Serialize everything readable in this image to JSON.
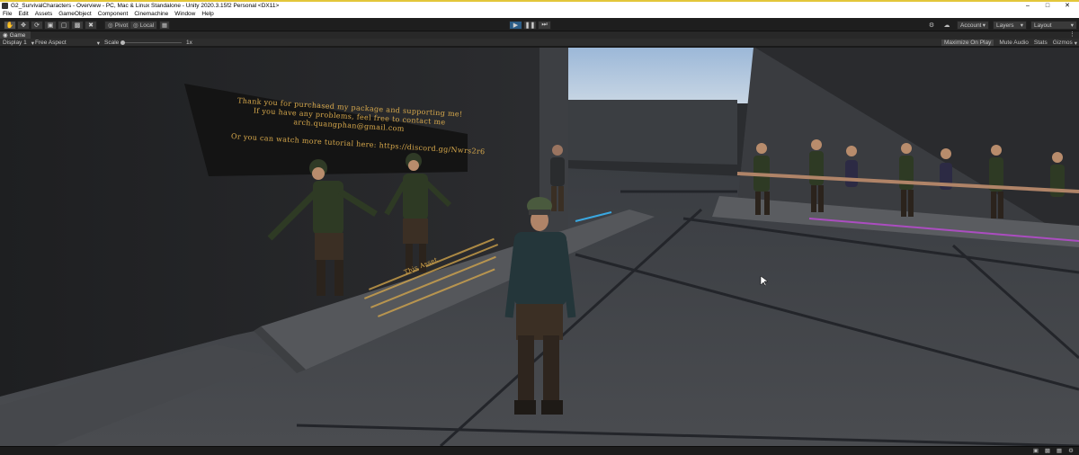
{
  "window": {
    "title": "G2_SurvivalCharacters - Overview - PC, Mac & Linux Standalone - Unity 2020.3.15f2 Personal <DX11>",
    "controls": [
      "–",
      "□",
      "✕"
    ]
  },
  "menu": [
    "File",
    "Edit",
    "Assets",
    "GameObject",
    "Component",
    "Cinemachine",
    "Window",
    "Help"
  ],
  "toolbar": {
    "tools": [
      "hand-icon",
      "move-icon",
      "rotate-icon",
      "scale-icon",
      "rect-icon",
      "transform-icon",
      "custom-tool-icon"
    ],
    "pivot_label": "Pivot",
    "local_label": "Local",
    "account_label": "Account",
    "layers_label": "Layers",
    "layout_label": "Layout"
  },
  "game_view": {
    "tab_label": "Game",
    "display_label": "Display 1",
    "aspect_label": "Free Aspect",
    "scale_label": "Scale",
    "scale_value": "1x",
    "maximize_label": "Maximize On Play",
    "mute_label": "Mute Audio",
    "stats_label": "Stats",
    "gizmos_label": "Gizmos"
  },
  "scene": {
    "sign_lines": [
      "Thank you for purchased my package and supporting me!",
      "If you have any problems, feel free to contact me",
      "arch.quangphan@gmail.com",
      "",
      "Or you can watch more tutorial here: https://discord.gg/Nwrs2r6"
    ],
    "floor_text": "This Asset"
  },
  "colors": {
    "accent_play": "#2c5d87",
    "sign_text": "#d8a94c",
    "floor_glow": "#c04ad8",
    "cyan_glow": "#3aa8e0"
  }
}
